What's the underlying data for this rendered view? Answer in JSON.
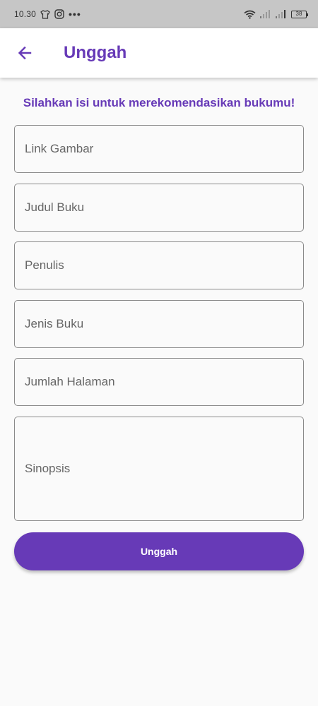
{
  "status_bar": {
    "time": "10.30",
    "battery": "38",
    "more": "•••"
  },
  "app_bar": {
    "title": "Unggah",
    "back_icon": "arrow-left-icon"
  },
  "form": {
    "instruction": "Silahkan isi untuk merekomendasikan bukumu!",
    "fields": {
      "image_link": "Link Gambar",
      "book_title": "Judul Buku",
      "author": "Penulis",
      "book_type": "Jenis Buku",
      "page_count": "Jumlah Halaman",
      "synopsis": "Sinopsis"
    },
    "submit_label": "Unggah"
  },
  "colors": {
    "primary": "#673ab7",
    "status_bar": "#c6c6c6",
    "background": "#fafafa"
  }
}
